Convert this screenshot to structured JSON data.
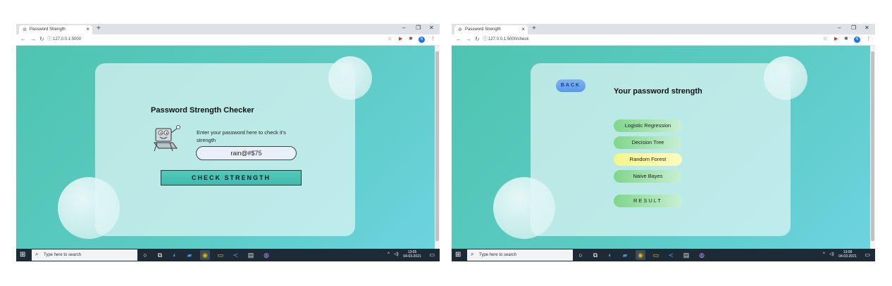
{
  "screens": {
    "left": {
      "browser": {
        "tab_title": "Password Strength",
        "url": "127.0.0.1:5000",
        "profile_initial": "N"
      },
      "page": {
        "title": "Password Strength Checker",
        "hint": "Enter your password here to check it's strength",
        "password_value": "rain@#$75",
        "check_button": "CHECK STRENGTH"
      },
      "taskbar": {
        "search_placeholder": "Type here to search",
        "time": "13:05",
        "date": "04-03-2021"
      }
    },
    "right": {
      "browser": {
        "tab_title": "Password Strength",
        "url": "127.0.0.1:5000/check",
        "profile_initial": "N"
      },
      "page": {
        "back_button": "BACK",
        "title": "Your password strength",
        "models": [
          {
            "label": "Logistic Regression",
            "color": "#9be0a7"
          },
          {
            "label": "Decision Tree",
            "color": "#9be0a7"
          },
          {
            "label": "Random Forest",
            "color": "#f8f89a"
          },
          {
            "label": "Naive Bayes",
            "color": "#9be0a7"
          }
        ],
        "result_button": "RESULT"
      },
      "taskbar": {
        "search_placeholder": "Type here to search",
        "time": "13:08",
        "date": "04-03-2021"
      }
    }
  },
  "icons": {
    "favicon": "globe-icon",
    "new_tab": "plus-icon",
    "minimize": "minimize-icon",
    "maximize": "maximize-icon",
    "close": "close-icon",
    "back": "arrow-left-icon",
    "forward": "arrow-right-icon",
    "reload": "reload-icon",
    "info": "info-icon",
    "bookmark": "star-icon",
    "start": "windows-icon",
    "search": "search-icon"
  },
  "colors": {
    "page_gradient_start": "#4fc4b2",
    "page_gradient_end": "#6cd3e0",
    "back_button": "#6aa6ef",
    "taskbar": "#1c2b36"
  }
}
